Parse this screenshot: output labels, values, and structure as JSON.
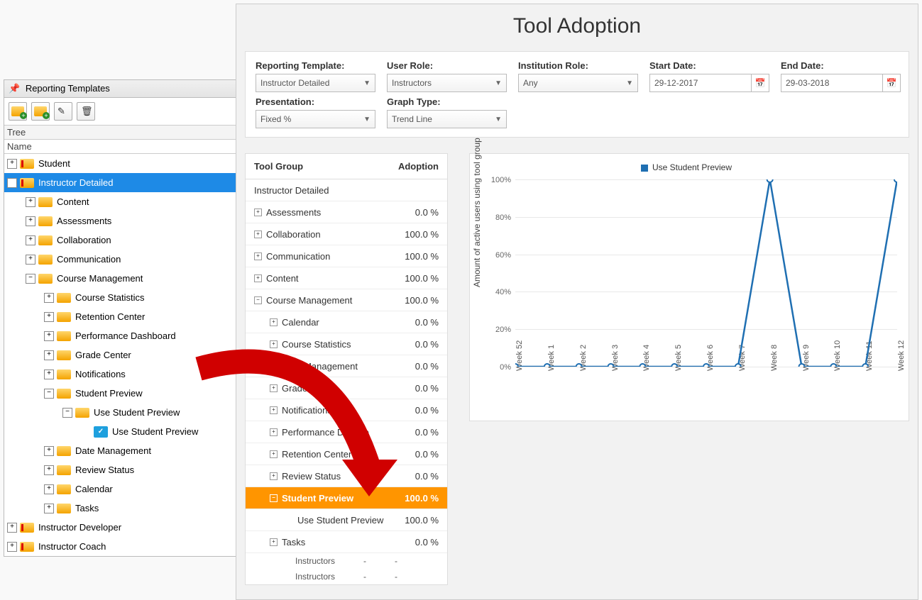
{
  "left_panel": {
    "title": "Reporting Templates",
    "tree_label": "Tree",
    "name_label": "Name",
    "roots": [
      {
        "label": "Student",
        "type": "template",
        "tog": "+",
        "depth": 0
      },
      {
        "label": "Instructor Detailed",
        "type": "template",
        "tog": "-",
        "depth": 0,
        "selected": true
      },
      {
        "label": "Content",
        "type": "folder",
        "tog": "+",
        "depth": 1
      },
      {
        "label": "Assessments",
        "type": "folder",
        "tog": "+",
        "depth": 1
      },
      {
        "label": "Collaboration",
        "type": "folder",
        "tog": "+",
        "depth": 1
      },
      {
        "label": "Communication",
        "type": "folder",
        "tog": "+",
        "depth": 1
      },
      {
        "label": "Course Management",
        "type": "folder",
        "tog": "-",
        "depth": 1
      },
      {
        "label": "Course Statistics",
        "type": "folder",
        "tog": "+",
        "depth": 2
      },
      {
        "label": "Retention Center",
        "type": "folder",
        "tog": "+",
        "depth": 2
      },
      {
        "label": "Performance Dashboard",
        "type": "folder",
        "tog": "+",
        "depth": 2
      },
      {
        "label": "Grade Center",
        "type": "folder",
        "tog": "+",
        "depth": 2
      },
      {
        "label": "Notifications",
        "type": "folder",
        "tog": "+",
        "depth": 2
      },
      {
        "label": "Student Preview",
        "type": "folder",
        "tog": "-",
        "depth": 2
      },
      {
        "label": "Use Student Preview",
        "type": "folder",
        "tog": "-",
        "depth": 3
      },
      {
        "label": "Use Student Preview",
        "type": "tool",
        "tog": "",
        "depth": 4
      },
      {
        "label": "Date Management",
        "type": "folder",
        "tog": "+",
        "depth": 2
      },
      {
        "label": "Review Status",
        "type": "folder",
        "tog": "+",
        "depth": 2
      },
      {
        "label": "Calendar",
        "type": "folder",
        "tog": "+",
        "depth": 2
      },
      {
        "label": "Tasks",
        "type": "folder",
        "tog": "+",
        "depth": 2
      },
      {
        "label": "Instructor Developer",
        "type": "template",
        "tog": "+",
        "depth": 0
      },
      {
        "label": "Instructor Coach",
        "type": "template",
        "tog": "+",
        "depth": 0
      }
    ]
  },
  "main": {
    "title": "Tool Adoption",
    "filters": {
      "reporting_template": {
        "label": "Reporting Template:",
        "value": "Instructor Detailed"
      },
      "user_role": {
        "label": "User Role:",
        "value": "Instructors"
      },
      "institution_role": {
        "label": "Institution Role:",
        "value": "Any"
      },
      "start_date": {
        "label": "Start Date:",
        "value": "29-12-2017"
      },
      "end_date": {
        "label": "End Date:",
        "value": "29-03-2018"
      },
      "presentation": {
        "label": "Presentation:",
        "value": "Fixed %"
      },
      "graph_type": {
        "label": "Graph Type:",
        "value": "Trend Line"
      }
    },
    "table": {
      "col1": "Tool Group",
      "col2": "Adoption",
      "section": "Instructor Detailed",
      "rows": [
        {
          "name": "Assessments",
          "val": "0.0 %",
          "exp": "+",
          "depth": 0
        },
        {
          "name": "Collaboration",
          "val": "100.0 %",
          "exp": "+",
          "depth": 0
        },
        {
          "name": "Communication",
          "val": "100.0 %",
          "exp": "+",
          "depth": 0
        },
        {
          "name": "Content",
          "val": "100.0 %",
          "exp": "+",
          "depth": 0
        },
        {
          "name": "Course Management",
          "val": "100.0 %",
          "exp": "-",
          "depth": 0
        },
        {
          "name": "Calendar",
          "val": "0.0 %",
          "exp": "+",
          "depth": 1
        },
        {
          "name": "Course Statistics",
          "val": "0.0 %",
          "exp": "+",
          "depth": 1
        },
        {
          "name": "Date Management",
          "val": "0.0 %",
          "exp": "+",
          "depth": 1
        },
        {
          "name": "Grade Center",
          "val": "0.0 %",
          "exp": "+",
          "depth": 1
        },
        {
          "name": "Notifications",
          "val": "0.0 %",
          "exp": "+",
          "depth": 1
        },
        {
          "name": "Performance Dashbo",
          "val": "0.0 %",
          "exp": "+",
          "depth": 1
        },
        {
          "name": "Retention Center",
          "val": "0.0 %",
          "exp": "+",
          "depth": 1
        },
        {
          "name": "Review Status",
          "val": "0.0 %",
          "exp": "+",
          "depth": 1
        },
        {
          "name": "Student Preview",
          "val": "100.0 %",
          "exp": "-",
          "depth": 1,
          "hl": true
        },
        {
          "name": "Use Student Preview",
          "val": "100.0 %",
          "exp": "",
          "depth": 2
        },
        {
          "name": "Tasks",
          "val": "0.0 %",
          "exp": "+",
          "depth": 1
        }
      ],
      "footer_rows": [
        {
          "role": "Instructors",
          "a": "-",
          "b": "-"
        },
        {
          "role": "Instructors",
          "a": "-",
          "b": "-"
        }
      ]
    }
  },
  "chart_data": {
    "type": "line",
    "title": "",
    "legend": "Use Student Preview",
    "ylabel": "Amount of active users using tool group",
    "yticks": [
      "0%",
      "20%",
      "40%",
      "60%",
      "80%",
      "100%"
    ],
    "ylim": [
      0,
      100
    ],
    "categories": [
      "Week 52",
      "Week 1",
      "Week 2",
      "Week 3",
      "Week 4",
      "Week 5",
      "Week 6",
      "Week 7",
      "Week 8",
      "Week 9",
      "Week 10",
      "Week 11",
      "Week 12"
    ],
    "series": [
      {
        "name": "Use Student Preview",
        "values": [
          0,
          0,
          0,
          0,
          0,
          0,
          0,
          0,
          100,
          0,
          0,
          0,
          100
        ]
      }
    ]
  }
}
